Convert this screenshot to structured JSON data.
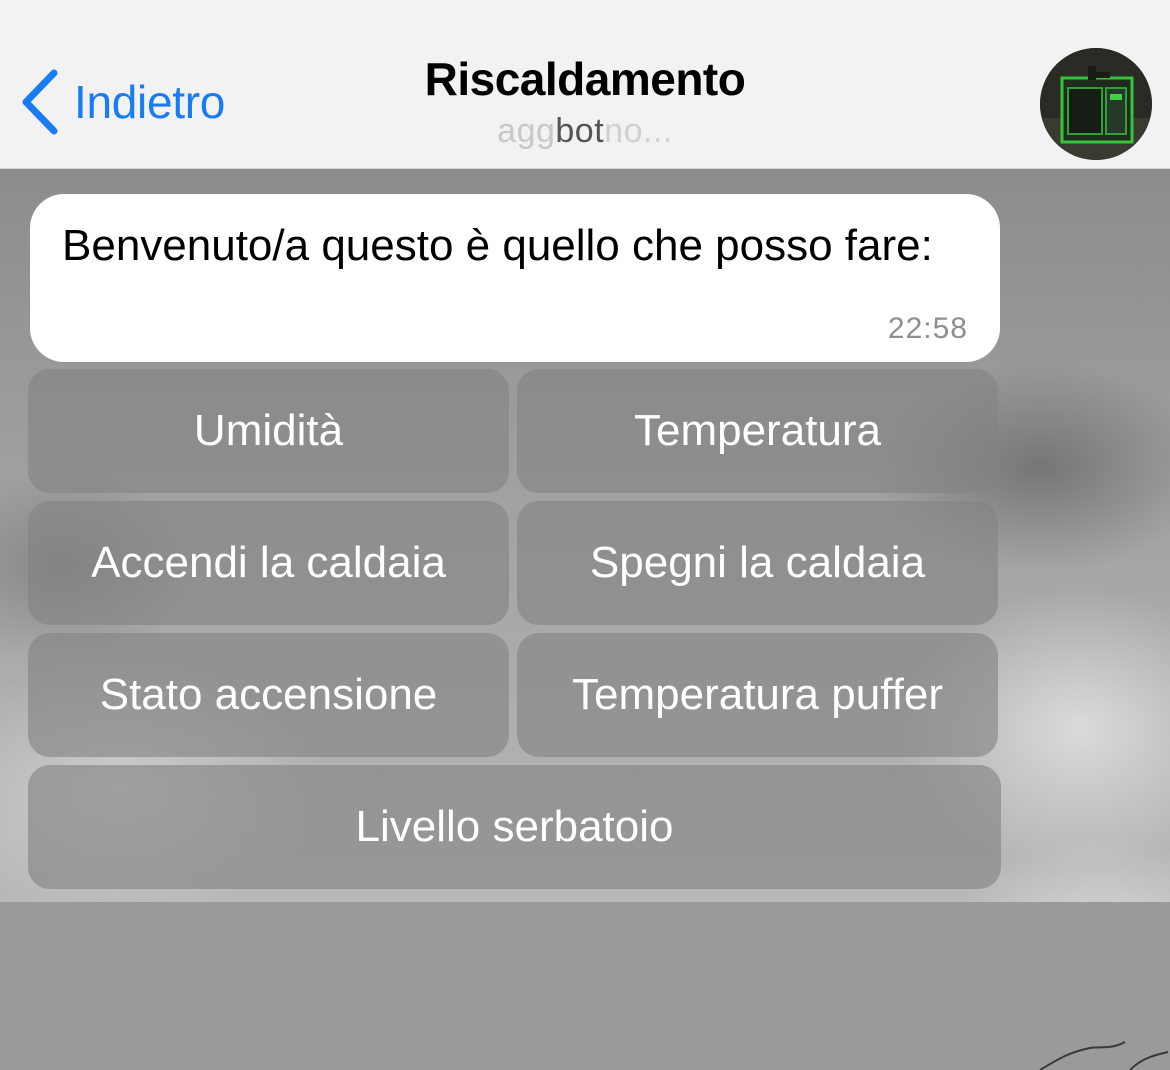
{
  "header": {
    "back_label": "Indietro",
    "title": "Riscaldamento",
    "subtitle": {
      "faded_left": "agg",
      "main": "bot",
      "faded_right": "no..."
    },
    "accent_color": "#1a7cf3"
  },
  "message": {
    "text": "Benvenuto/a questo è quello che posso fare:",
    "time": "22:58"
  },
  "keyboard": {
    "buttons": [
      {
        "label": "Umidità"
      },
      {
        "label": "Temperatura"
      },
      {
        "label": "Accendi la caldaia"
      },
      {
        "label": "Spegni la caldaia"
      },
      {
        "label": "Stato accensione"
      },
      {
        "label": "Temperatura puffer"
      },
      {
        "label": "Livello serbatoio"
      }
    ]
  },
  "icons": {
    "back": "chevron-left-icon",
    "avatar": "boiler-avatar"
  }
}
